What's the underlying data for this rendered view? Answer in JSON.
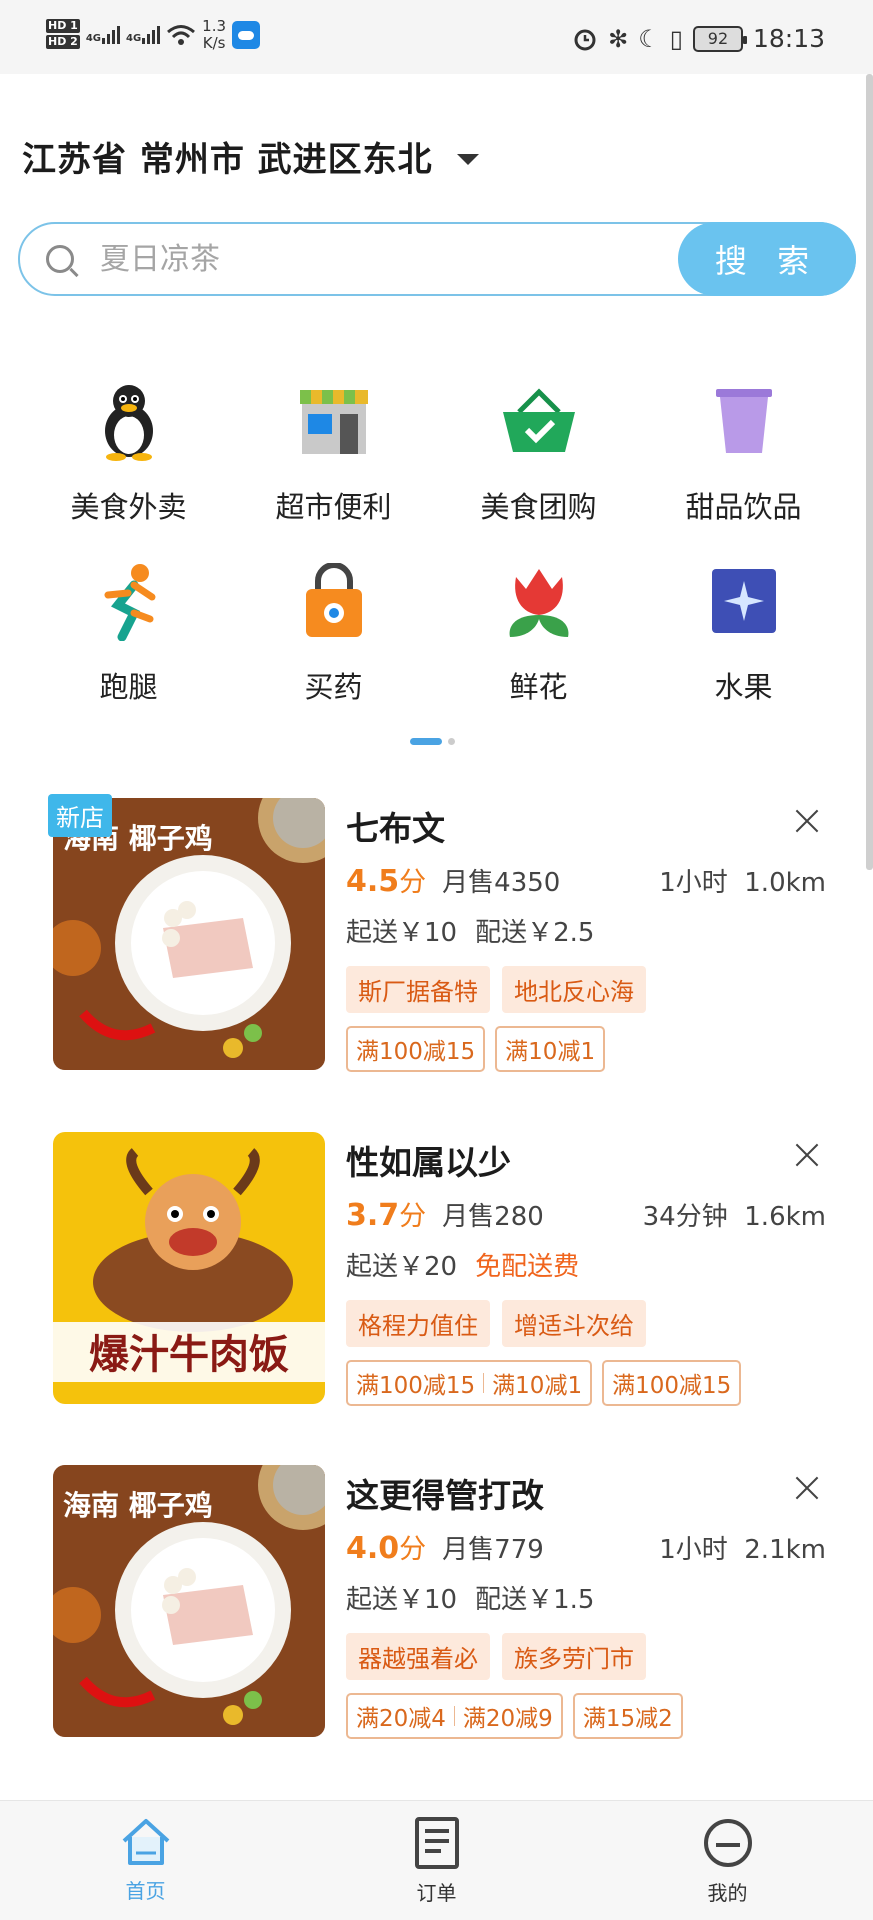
{
  "status_bar": {
    "hd1": "HD 1",
    "hd2": "HD 2",
    "net1": "4G",
    "net2": "4G",
    "speed_value": "1.3",
    "speed_unit": "K/s",
    "battery": "92",
    "time": "18:13"
  },
  "location": {
    "text": "江苏省 常州市 武进区东北"
  },
  "search": {
    "placeholder": "夏日凉茶",
    "button_label": "搜 索"
  },
  "categories": [
    {
      "label": "美食外卖",
      "icon": "penguin-icon"
    },
    {
      "label": "超市便利",
      "icon": "store-icon"
    },
    {
      "label": "美食团购",
      "icon": "basket-icon"
    },
    {
      "label": "甜品饮品",
      "icon": "cup-icon"
    },
    {
      "label": "跑腿",
      "icon": "runner-icon"
    },
    {
      "label": "买药",
      "icon": "lock-bag-icon"
    },
    {
      "label": "鲜花",
      "icon": "tulip-icon"
    },
    {
      "label": "水果",
      "icon": "star-burst-icon"
    }
  ],
  "shops": [
    {
      "badge": "新店",
      "name": "七布文",
      "score": "4.5",
      "score_unit": "分",
      "monthly_sales": "月售4350",
      "time": "1小时",
      "distance": "1.0km",
      "min_order": "起送￥10",
      "delivery_fee": "配送￥2.5",
      "tags": [
        "斯厂据备特",
        "地北反心海"
      ],
      "promos": [
        [
          "满100减15"
        ],
        [
          "满10减1"
        ]
      ],
      "image_text": "海南 椰子鸡"
    },
    {
      "badge": "",
      "name": "性如属以少",
      "score": "3.7",
      "score_unit": "分",
      "monthly_sales": "月售280",
      "time": "34分钟",
      "distance": "1.6km",
      "min_order": "起送￥20",
      "delivery_fee": "免配送费",
      "tags": [
        "格程力值住",
        "增适斗次给"
      ],
      "promos": [
        [
          "满100减15",
          "满10减1"
        ],
        [
          "满100减15"
        ]
      ],
      "image_text": "爆汁牛肉饭"
    },
    {
      "badge": "",
      "name": "这更得管打改",
      "score": "4.0",
      "score_unit": "分",
      "monthly_sales": "月售779",
      "time": "1小时",
      "distance": "2.1km",
      "min_order": "起送￥10",
      "delivery_fee": "配送￥1.5",
      "tags": [
        "器越强着必",
        "族多劳门市"
      ],
      "promos": [
        [
          "满20减4",
          "满20减9"
        ],
        [
          "满15减2"
        ]
      ],
      "image_text": "海南 椰子鸡"
    }
  ],
  "bottom_nav": [
    {
      "label": "首页",
      "icon": "home-icon",
      "active": true
    },
    {
      "label": "订单",
      "icon": "order-icon",
      "active": false
    },
    {
      "label": "我的",
      "icon": "profile-icon",
      "active": false
    }
  ],
  "colors": {
    "accent": "#4aa3e3",
    "search_button": "#6ac3ef",
    "score": "#f07d1c",
    "tag_bg": "#fde9dc",
    "tag_text": "#d95a14"
  }
}
